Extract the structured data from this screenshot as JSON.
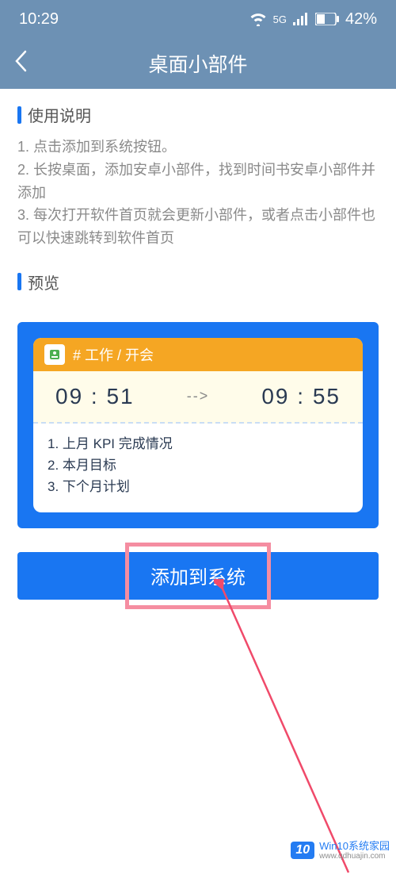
{
  "status": {
    "time": "10:29",
    "net": "5G",
    "battery": "42%"
  },
  "header": {
    "title": "桌面小部件"
  },
  "sections": {
    "usage": {
      "title": "使用说明",
      "lines": [
        "1. 点击添加到系统按钮。",
        "2. 长按桌面，添加安卓小部件，找到时间书安卓小部件并添加",
        "3. 每次打开软件首页就会更新小部件，或者点击小部件也可以快速跳转到软件首页"
      ]
    },
    "preview": {
      "title": "预览"
    }
  },
  "widget": {
    "tag": "# 工作 / 开会",
    "start": "09 : 51",
    "arrow": "-->",
    "end": "09 : 55",
    "items": [
      "1. 上月 KPI 完成情况",
      "2. 本月目标",
      "3. 下个月计划"
    ]
  },
  "button": {
    "label": "添加到系统"
  },
  "watermark": {
    "badge": "10",
    "brand": "Win10系统家园",
    "url": "www.qdhuajin.com"
  }
}
